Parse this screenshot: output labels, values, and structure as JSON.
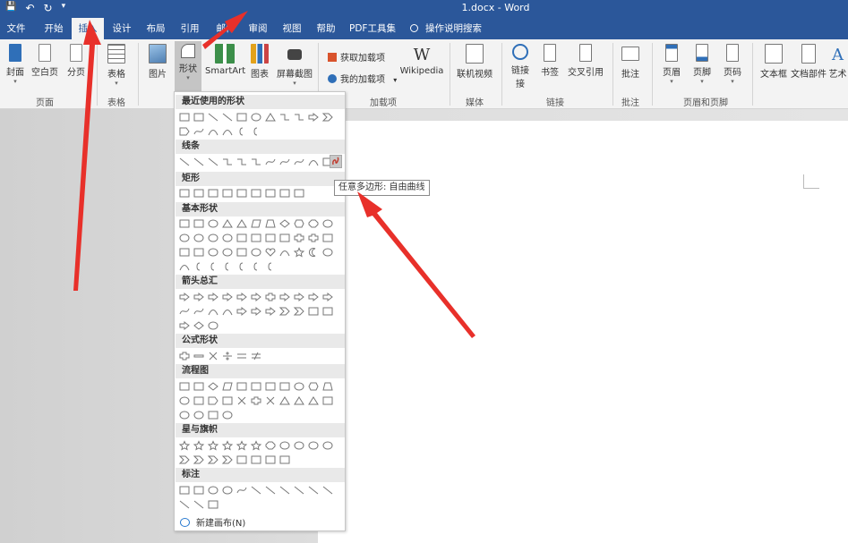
{
  "title_bar": {
    "doc_title": "1.docx - Word",
    "qat": {
      "save": "💾",
      "undo": "↶",
      "redo": "↻",
      "more": "▾"
    }
  },
  "tabs": [
    {
      "label": "文件"
    },
    {
      "label": "开始"
    },
    {
      "label": "插入"
    },
    {
      "label": "设计"
    },
    {
      "label": "布局"
    },
    {
      "label": "引用"
    },
    {
      "label": "邮件"
    },
    {
      "label": "审阅"
    },
    {
      "label": "视图"
    },
    {
      "label": "帮助"
    },
    {
      "label": "PDF工具集"
    },
    {
      "label": "操作说明搜索"
    }
  ],
  "active_tab": "插入",
  "ribbon": {
    "buttons": {
      "cover": "封面",
      "blank": "空白页",
      "break": "分页",
      "table": "表格",
      "picture": "图片",
      "shapes": "形状",
      "smartart": "SmartArt",
      "chart": "图表",
      "screenshot": "屏幕截图",
      "get_addins": "获取加载项",
      "my_addins": "我的加载项",
      "wikipedia": "Wikipedia",
      "online_video": "联机视频",
      "link": "链接",
      "link2": "接",
      "bookmark": "书签",
      "cross_ref": "交叉引用",
      "comment": "批注",
      "header": "页眉",
      "footer": "页脚",
      "page_number": "页码",
      "textbox": "文本框",
      "quick_parts": "文档部件",
      "wordart": "艺术"
    },
    "groups": {
      "pages": "页面",
      "tables": "表格",
      "addins": "加载项",
      "media": "媒体",
      "links": "链接",
      "comments": "批注",
      "header_footer": "页眉和页脚"
    },
    "wikipedia_logo": "W"
  },
  "shapes_panel": {
    "sections": {
      "recent": "最近使用的形状",
      "lines": "线条",
      "rectangles": "矩形",
      "basic": "基本形状",
      "arrows": "箭头总汇",
      "equation": "公式形状",
      "flowchart": "流程图",
      "stars": "星与旗帜",
      "callouts": "标注"
    },
    "new_canvas": "新建画布(N)"
  },
  "tooltip": "任意多边形: 自由曲线",
  "colors": {
    "brand": "#2b579a",
    "annotation": "#e8302a"
  }
}
